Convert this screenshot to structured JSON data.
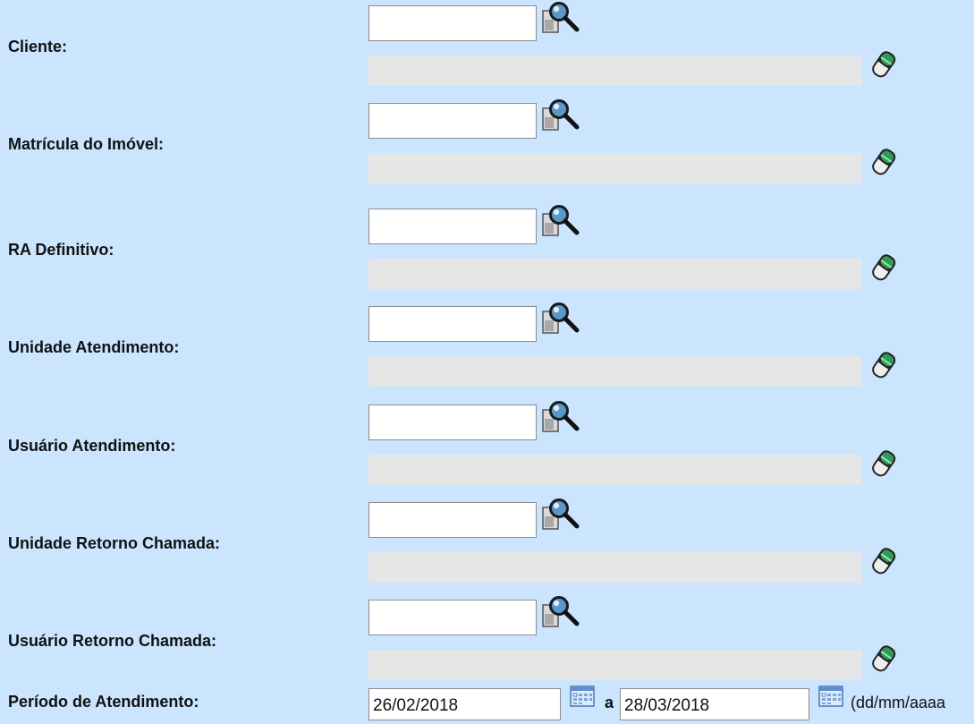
{
  "filters": [
    {
      "label": "Cliente:",
      "code_value": "",
      "description": ""
    },
    {
      "label": "Matrícula do Imóvel:",
      "code_value": "",
      "description": ""
    },
    {
      "label": "RA Definitivo:",
      "code_value": "",
      "description": ""
    },
    {
      "label": "Unidade Atendimento:",
      "code_value": "",
      "description": ""
    },
    {
      "label": "Usuário Atendimento:",
      "code_value": "",
      "description": ""
    },
    {
      "label": "Unidade Retorno Chamada:",
      "code_value": "",
      "description": ""
    },
    {
      "label": "Usuário Retorno Chamada:",
      "code_value": "",
      "description": ""
    }
  ],
  "period": {
    "label": "Período de Atendimento:",
    "start_date": "26/02/2018",
    "separator": "a",
    "end_date": "28/03/2018",
    "format_hint": "(dd/mm/aaaa"
  },
  "icons": {
    "search": "magnifier-search-icon",
    "clear": "eraser-icon",
    "calendar": "calendar-icon"
  },
  "colors": {
    "background": "#cbe5fe",
    "readonly_field": "#e6e6e6",
    "input_border": "#8c8c8c"
  }
}
